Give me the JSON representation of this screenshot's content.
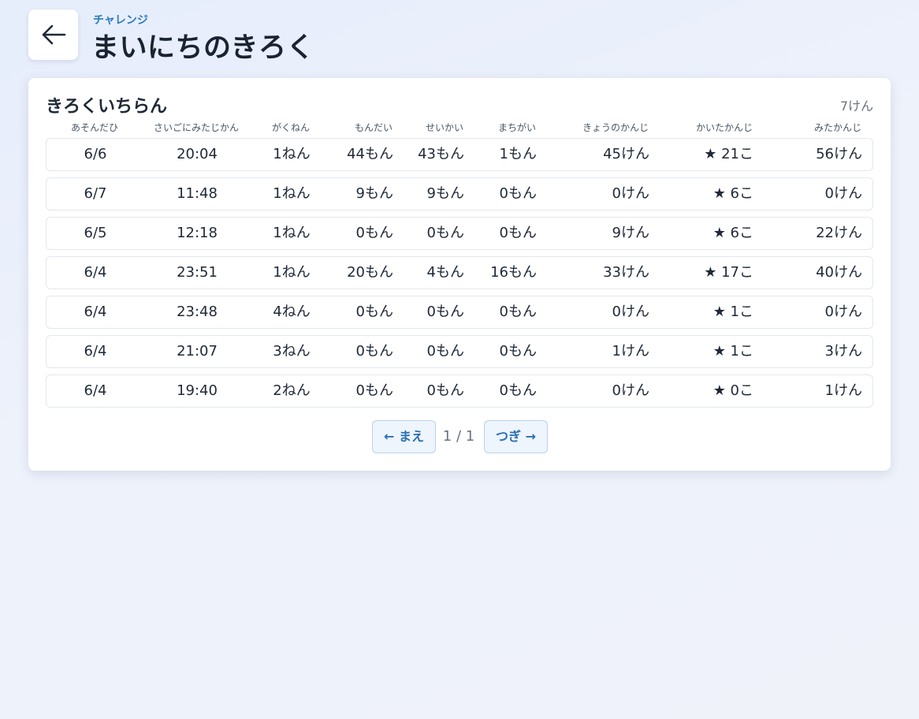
{
  "header": {
    "back_icon": "arrow-left-icon",
    "subtitle": "チャレンジ",
    "title": "まいにちのきろく"
  },
  "records": {
    "title": "きろくいちらん",
    "count": "7けん",
    "columns": [
      "あそんだひ",
      "さいごにみたじかん",
      "がくねん",
      "もんだい",
      "せいかい",
      "まちがい",
      "きょうのかんじ",
      "かいたかんじ",
      "みたかんじ"
    ],
    "rows": [
      [
        "6/6",
        "20:04",
        "1ねん",
        "44もん",
        "43もん",
        "1もん",
        "45けん",
        "★ 21こ",
        "56けん"
      ],
      [
        "6/7",
        "11:48",
        "1ねん",
        "9もん",
        "9もん",
        "0もん",
        "0けん",
        "★ 6こ",
        "0けん"
      ],
      [
        "6/5",
        "12:18",
        "1ねん",
        "0もん",
        "0もん",
        "0もん",
        "9けん",
        "★ 6こ",
        "22けん"
      ],
      [
        "6/4",
        "23:51",
        "1ねん",
        "20もん",
        "4もん",
        "16もん",
        "33けん",
        "★ 17こ",
        "40けん"
      ],
      [
        "6/4",
        "23:48",
        "4ねん",
        "0もん",
        "0もん",
        "0もん",
        "0けん",
        "★ 1こ",
        "0けん"
      ],
      [
        "6/4",
        "21:07",
        "3ねん",
        "0もん",
        "0もん",
        "0もん",
        "1けん",
        "★ 1こ",
        "3けん"
      ],
      [
        "6/4",
        "19:40",
        "2ねん",
        "0もん",
        "0もん",
        "0もん",
        "0けん",
        "★ 0こ",
        "1けん"
      ]
    ]
  },
  "pager": {
    "prev_label": "← まえ",
    "page_info": "1 / 1",
    "next_label": "つぎ →"
  },
  "colors": {
    "accent": "#2b7bc0",
    "button_bg": "#eef5fd",
    "text": "#1f2937"
  }
}
